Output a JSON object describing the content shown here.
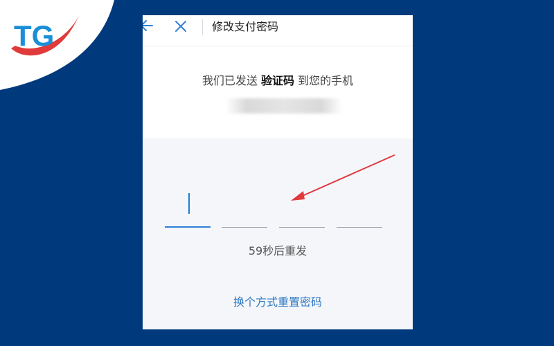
{
  "logo": {
    "text": "TG",
    "colors": {
      "blue": "#1a8fd8",
      "red": "#e03a3a"
    }
  },
  "header": {
    "back_icon": "arrow-left-icon",
    "close_icon": "close-icon",
    "title": "修改支付密码"
  },
  "verification": {
    "sent_prefix": "我们已发送 ",
    "sent_bold": "验证码",
    "sent_suffix": " 到您的手机",
    "phone_prefix": "1",
    "code_length": 4,
    "countdown": "59秒后重发",
    "alt_link": "换个方式重置密码"
  },
  "colors": {
    "background": "#003a7c",
    "accent": "#2f7fd6",
    "annotation_arrow": "#e0393e"
  }
}
